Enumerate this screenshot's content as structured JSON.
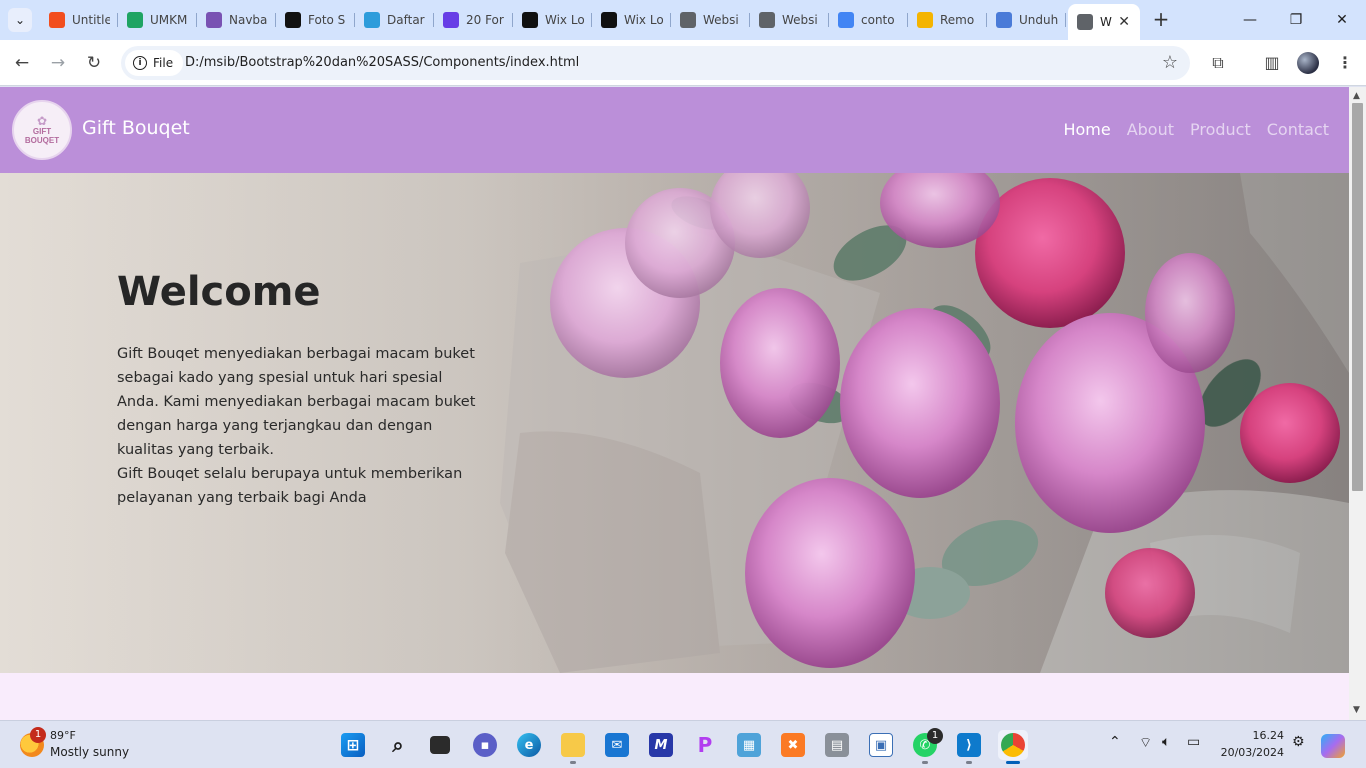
{
  "browser": {
    "tabs": [
      {
        "label": "Untitle",
        "icon": "figma-icon",
        "color": "#f24e1e"
      },
      {
        "label": "UMKM",
        "icon": "google-drive-icon",
        "color": "#1fa463"
      },
      {
        "label": "Navba",
        "icon": "bootstrap-icon",
        "color": "#7952b3"
      },
      {
        "label": "Foto S",
        "icon": "istock-icon",
        "color": "#111111"
      },
      {
        "label": "Daftar",
        "icon": "daftar-icon",
        "color": "#2d9cdb"
      },
      {
        "label": "20 For",
        "icon": "hostinger-icon",
        "color": "#673de6"
      },
      {
        "label": "Wix Lo",
        "icon": "wix-icon",
        "color": "#111111"
      },
      {
        "label": "Wix Lo",
        "icon": "wix-icon",
        "color": "#111111"
      },
      {
        "label": "Websi",
        "icon": "globe-icon",
        "color": "#5f6368"
      },
      {
        "label": "Websi",
        "icon": "globe-icon",
        "color": "#5f6368"
      },
      {
        "label": "conto",
        "icon": "google-icon",
        "color": "#4285f4"
      },
      {
        "label": "Remo",
        "icon": "remove-icon",
        "color": "#f4b400"
      },
      {
        "label": "Unduh",
        "icon": "heart-icon",
        "color": "#4a7bd8"
      },
      {
        "label": "W",
        "icon": "globe-icon",
        "color": "#5f6368",
        "active": true
      }
    ],
    "address": {
      "chip_label": "File",
      "url": "D:/msib/Bootstrap%20dan%20SASS/Components/index.html"
    }
  },
  "site": {
    "logo_text_line1": "GIFT",
    "logo_text_line2": "BOUQET",
    "brand": "Gift Bouqet",
    "menu": [
      "Home",
      "About",
      "Product",
      "Contact"
    ],
    "hero": {
      "title": "Welcome",
      "paragraph1": "Gift Bouqet menyediakan berbagai macam buket sebagai kado yang spesial untuk hari spesial Anda. Kami menyediakan berbagai macam buket dengan harga yang terjangkau dan dengan kualitas yang terbaik.",
      "paragraph2": "Gift Bouqet selalu berupaya untuk memberikan pelayanan yang terbaik bagi Anda"
    },
    "colors": {
      "navbar": "#bb8fd9",
      "page_bg": "#f9ecfc"
    }
  },
  "taskbar": {
    "weather_temp": "89°F",
    "weather_desc": "Mostly sunny",
    "weather_badge": "1",
    "whatsapp_badge": "1",
    "time": "16.24",
    "date": "20/03/2024"
  }
}
